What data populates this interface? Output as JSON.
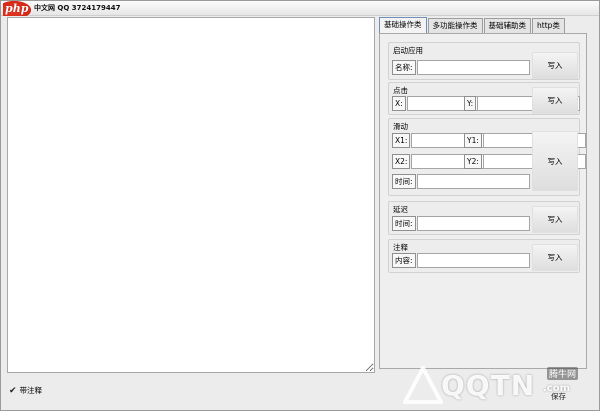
{
  "window": {
    "logo_text": "php",
    "title": "中文网 QQ 3724179447"
  },
  "tabs": [
    {
      "label": "基础操作类"
    },
    {
      "label": "多功能操作类"
    },
    {
      "label": "基础辅助类"
    },
    {
      "label": "http类"
    }
  ],
  "groups": {
    "launch": {
      "title": "启动应用",
      "name_label": "名称:",
      "write": "写入"
    },
    "click": {
      "title": "点击",
      "x_label": "X:",
      "y_label": "Y:",
      "write": "写入"
    },
    "swipe": {
      "title": "滑动",
      "x1_label": "X1:",
      "y1_label": "Y1:",
      "x2_label": "X2:",
      "y2_label": "Y2:",
      "time_label": "时间:",
      "write": "写入"
    },
    "delay": {
      "title": "延迟",
      "time_label": "时间:",
      "write": "写入"
    },
    "comment": {
      "title": "注释",
      "content_label": "内容:",
      "write": "写入"
    }
  },
  "bottom": {
    "checkbox_label": "带注释",
    "checked": true,
    "save_label": "保存"
  },
  "watermark": {
    "brand": "QQTN",
    "suffix": ".com",
    "cn": "腾牛网"
  }
}
